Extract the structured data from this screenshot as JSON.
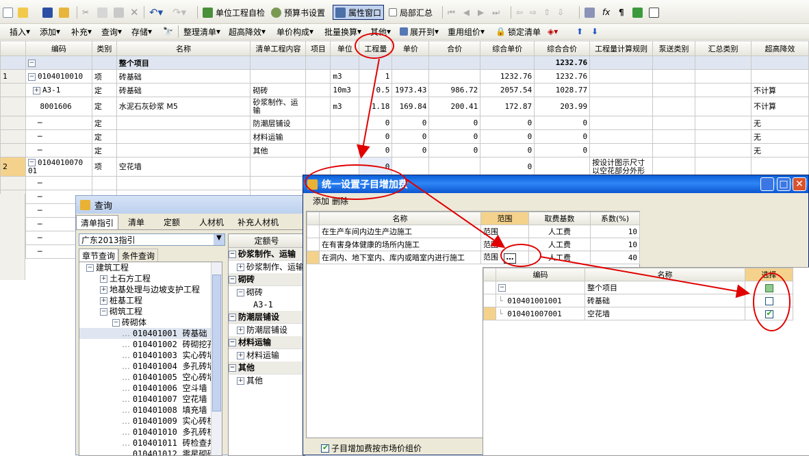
{
  "toolbar1": {
    "self_check": "单位工程自检",
    "budget_settings": "预算书设置",
    "property_window": "属性窗口",
    "local_summary": "局部汇总"
  },
  "toolbar2": {
    "insert": "插入",
    "add": "添加",
    "supplement": "补充",
    "query": "查询",
    "store": "存储",
    "organize_list": "整理清单",
    "over_height": "超高降效",
    "unit_price_comp": "单价构成",
    "batch_replace": "批量换算",
    "other": "其他",
    "expand_to": "展开到",
    "reuse_price": "重用组价",
    "lock_list": "锁定清单"
  },
  "grid": {
    "headers": [
      "编码",
      "类别",
      "名称",
      "清单工程内容",
      "项目",
      "单位",
      "工程量",
      "单价",
      "合价",
      "综合单价",
      "综合合价",
      "工程量计算规则",
      "泵送类别",
      "汇总类别",
      "超高降效"
    ],
    "whole_project": "整个项目",
    "whole_total": "1232.76",
    "rows": [
      {
        "no": "1",
        "code": "0104010010",
        "type": "项",
        "name": "砖基础",
        "content": "",
        "unit": "m3",
        "qty": "1",
        "price": "",
        "total": "",
        "cprice": "1232.76",
        "ctotal": "1232.76",
        "rule": "",
        "reduce": ""
      },
      {
        "no": "",
        "code": "A3-1",
        "type": "定",
        "name": "砖基础",
        "content": "砌砖",
        "unit": "10m3",
        "qty": "0.5",
        "price": "1973.43",
        "total": "986.72",
        "cprice": "2057.54",
        "ctotal": "1028.77",
        "rule": "",
        "reduce": "不计算"
      },
      {
        "no": "",
        "code": "8001606",
        "type": "定",
        "name": "水泥石灰砂浆 M5",
        "content": "砂浆制作、运输",
        "unit": "m3",
        "qty": "1.18",
        "price": "169.84",
        "total": "200.41",
        "cprice": "172.87",
        "ctotal": "203.99",
        "rule": "",
        "reduce": "不计算"
      },
      {
        "no": "",
        "code": "",
        "type": "定",
        "name": "",
        "content": "防潮层铺设",
        "unit": "",
        "qty": "0",
        "price": "0",
        "total": "0",
        "cprice": "0",
        "ctotal": "0",
        "rule": "",
        "reduce": "无"
      },
      {
        "no": "",
        "code": "",
        "type": "定",
        "name": "",
        "content": "材料运输",
        "unit": "",
        "qty": "0",
        "price": "0",
        "total": "0",
        "cprice": "0",
        "ctotal": "0",
        "rule": "",
        "reduce": "无"
      },
      {
        "no": "",
        "code": "",
        "type": "定",
        "name": "",
        "content": "其他",
        "unit": "",
        "qty": "0",
        "price": "0",
        "total": "0",
        "cprice": "0",
        "ctotal": "0",
        "rule": "",
        "reduce": "无"
      },
      {
        "no": "2",
        "code": "0104010070 01",
        "type": "项",
        "name": "空花墙",
        "content": "",
        "unit": "",
        "qty": "0",
        "price": "",
        "total": "",
        "cprice": "0",
        "ctotal": "",
        "rule": "按设计图示尺寸以空花部分外形",
        "reduce": ""
      }
    ]
  },
  "query": {
    "title": "查询",
    "tabs": [
      "清单指引",
      "清单",
      "定额",
      "人材机",
      "补充人材机"
    ],
    "dropdown": "广东2013指引",
    "subtabs": [
      "章节查询",
      "条件查询"
    ],
    "tree": [
      "建筑工程",
      "土石方工程",
      "地基处理与边坡支护工程",
      "桩基工程",
      "砌筑工程",
      "砖砌体"
    ],
    "items": [
      {
        "code": "010401001",
        "name": "砖基础"
      },
      {
        "code": "010401002",
        "name": "砖砌挖孔"
      },
      {
        "code": "010401003",
        "name": "实心砖墙"
      },
      {
        "code": "010401004",
        "name": "多孔砖墙"
      },
      {
        "code": "010401005",
        "name": "空心砖墙"
      },
      {
        "code": "010401006",
        "name": "空斗墙"
      },
      {
        "code": "010401007",
        "name": "空花墙"
      },
      {
        "code": "010401008",
        "name": "填充墙"
      },
      {
        "code": "010401009",
        "name": "实心砖柱"
      },
      {
        "code": "010401010",
        "name": "多孔砖柱"
      },
      {
        "code": "010401011",
        "name": "砖检查井"
      },
      {
        "code": "010401012",
        "name": "零星砌砖"
      }
    ],
    "right_header": "定额号",
    "groups": [
      {
        "name": "砂浆制作、运输",
        "child": "砂浆制作、运输"
      },
      {
        "name": "砌砖",
        "child": "砌砖",
        "sub": "A3-1"
      },
      {
        "name": "防潮层铺设",
        "child": "防潮层铺设"
      },
      {
        "name": "材料运输",
        "child": "材料运输"
      },
      {
        "name": "其他",
        "child": "其他"
      }
    ]
  },
  "dialog": {
    "title": "统一设置子目增加费",
    "add": "添加",
    "delete": "删除",
    "headers": [
      "名称",
      "范围",
      "取费基数",
      "系数(%)"
    ],
    "rows": [
      {
        "name": "在生产车间内边生产边施工",
        "scope": "范围",
        "base": "人工费",
        "coef": "10"
      },
      {
        "name": "在有害身体健康的场所内施工",
        "scope": "范围",
        "base": "人工费",
        "coef": "10"
      },
      {
        "name": "在洞内、地下室内、库内或暗室内进行施工",
        "scope": "范围",
        "base": "人工费",
        "coef": "40"
      }
    ],
    "checkbox_label": "子目增加费按市场价组价",
    "scope_headers": [
      "编码",
      "名称",
      "选择"
    ],
    "scope_whole": "整个项目",
    "scope_rows": [
      {
        "code": "010401001001",
        "name": "砖基础",
        "checked": false
      },
      {
        "code": "010401007001",
        "name": "空花墙",
        "checked": true
      }
    ]
  }
}
